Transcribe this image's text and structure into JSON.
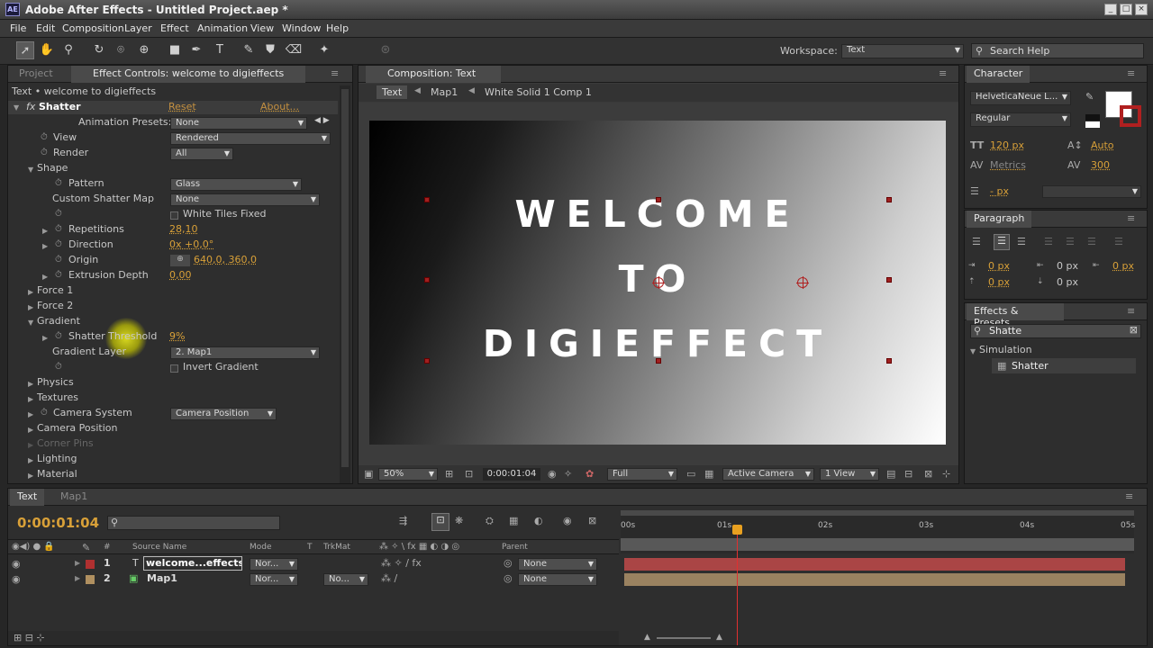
{
  "window": {
    "title": "Adobe After Effects - Untitled Project.aep *",
    "logo": "AE"
  },
  "menu": [
    "File",
    "Edit",
    "Composition",
    "Layer",
    "Effect",
    "Animation",
    "View",
    "Window",
    "Help"
  ],
  "toolbar": {
    "workspace_label": "Workspace:",
    "workspace_value": "Text",
    "search_placeholder": "Search Help"
  },
  "project_panel": {
    "tab_project": "Project",
    "tab_effect_controls": "Effect Controls: welcome to digieffects",
    "header": "Text • welcome to digieffects",
    "effect_name": "Shatter",
    "reset": "Reset",
    "about": "About...",
    "animation_presets_label": "Animation Presets:",
    "animation_presets_value": "None",
    "props": {
      "view": "View",
      "view_value": "Rendered",
      "render": "Render",
      "render_value": "All",
      "shape": "Shape",
      "pattern": "Pattern",
      "pattern_value": "Glass",
      "custom_map": "Custom Shatter Map",
      "custom_map_value": "None",
      "white_tiles": "White Tiles Fixed",
      "repetitions": "Repetitions",
      "repetitions_value": "28,10",
      "direction": "Direction",
      "direction_value": "0x +0,0°",
      "origin": "Origin",
      "origin_value": "640,0, 360,0",
      "extrusion": "Extrusion Depth",
      "extrusion_value": "0,00",
      "force1": "Force 1",
      "force2": "Force 2",
      "gradient": "Gradient",
      "shatter_threshold": "Shatter Threshold",
      "shatter_threshold_value": "9%",
      "gradient_layer": "Gradient Layer",
      "gradient_layer_value": "2. Map1",
      "invert_gradient": "Invert Gradient",
      "physics": "Physics",
      "textures": "Textures",
      "camera_system": "Camera System",
      "camera_system_value": "Camera Position",
      "camera_position": "Camera Position",
      "corner_pins": "Corner Pins",
      "lighting": "Lighting",
      "material": "Material"
    }
  },
  "composition": {
    "tab": "Composition: Text",
    "crumbs": [
      "Text",
      "Map1",
      "White Solid 1 Comp 1"
    ],
    "viewer_lines": [
      "WELCOME",
      "TO",
      "DIGIEFFECT"
    ],
    "zoom": "50%",
    "timecode": "0:00:01:04",
    "resolution": "Full",
    "camera": "Active Camera",
    "views": "1 View"
  },
  "character": {
    "tab": "Character",
    "font": "HelveticaNeue L...",
    "style": "Regular",
    "size": "120 px",
    "leading": "Auto",
    "kerning": "Metrics",
    "tracking": "300",
    "stroke": "- px"
  },
  "paragraph": {
    "tab": "Paragraph",
    "indent1": "0 px",
    "indent2": "0 px",
    "indent3": "0 px",
    "space1": "0 px",
    "space2": "0 px"
  },
  "effects_presets": {
    "tab": "Effects & Presets",
    "search": "Shatte",
    "category": "Simulation",
    "item": "Shatter"
  },
  "timeline": {
    "tab_text": "Text",
    "tab_map": "Map1",
    "timecode": "0:00:01:04",
    "columns": {
      "source": "Source Name",
      "mode": "Mode",
      "t": "T",
      "trkmat": "TrkMat",
      "parent": "Parent"
    },
    "ruler": [
      "00s",
      "01s",
      "02s",
      "03s",
      "04s",
      "05s"
    ],
    "layers": [
      {
        "num": "1",
        "name": "welcome...effects",
        "mode": "Nor...",
        "trkmat": "",
        "parent": "None",
        "color": "#b03030",
        "bar": "#b84848"
      },
      {
        "num": "2",
        "name": "Map1",
        "mode": "Nor...",
        "trkmat": "No...",
        "parent": "None",
        "color": "#b09060",
        "bar": "#9a8260"
      }
    ]
  }
}
